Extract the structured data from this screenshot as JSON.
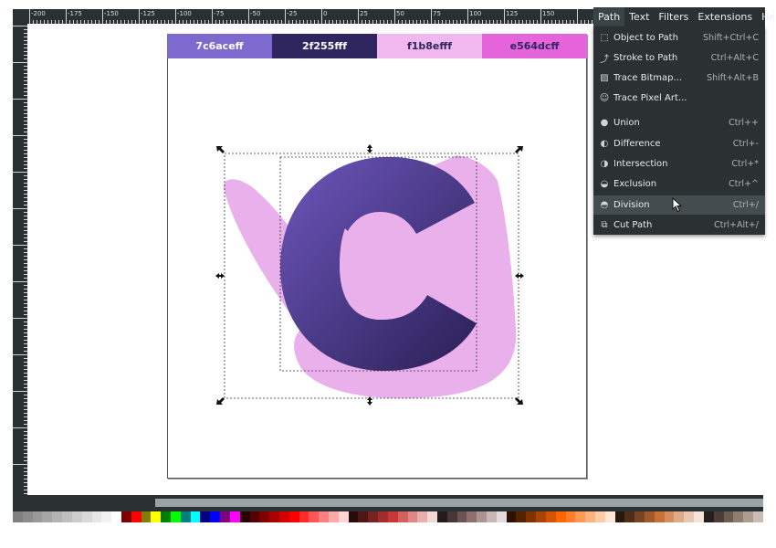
{
  "rulers": {
    "top_labels": [
      "-200",
      "-175",
      "-150",
      "-125",
      "-100",
      "-75",
      "-50",
      "-25",
      "0",
      "25",
      "50",
      "75",
      "100",
      "125",
      "150"
    ]
  },
  "swatches": [
    {
      "label": "7c6aceff",
      "bg": "#7c6ace",
      "fg": "#ffffff"
    },
    {
      "label": "2f255fff",
      "bg": "#2f255f",
      "fg": "#ffffff"
    },
    {
      "label": "f1b8efff",
      "bg": "#f1b8ef",
      "fg": "#2f255f"
    },
    {
      "label": "e564dcff",
      "bg": "#e564dc",
      "fg": "#2f255f"
    }
  ],
  "colors": {
    "pink_shape": "#eab0ec",
    "gradient_light": "#6e57bd",
    "gradient_dark": "#2a1f55"
  },
  "menubar": {
    "path": "Path",
    "text": "Text",
    "filters": "Filters",
    "extensions": "Extensions",
    "help": "Help"
  },
  "menu": {
    "object_to_path": {
      "label": "Object to Path",
      "shortcut": "Shift+Ctrl+C",
      "icon": "object-to-path-icon"
    },
    "stroke_to_path": {
      "label": "Stroke to Path",
      "shortcut": "Ctrl+Alt+C",
      "icon": "stroke-to-path-icon"
    },
    "trace_bitmap": {
      "label": "Trace Bitmap...",
      "shortcut": "Shift+Alt+B",
      "icon": "trace-bitmap-icon"
    },
    "trace_pixel_art": {
      "label": "Trace Pixel Art...",
      "shortcut": "",
      "icon": "trace-pixel-art-icon"
    },
    "union": {
      "label": "Union",
      "shortcut": "Ctrl++",
      "icon": "union-icon"
    },
    "difference": {
      "label": "Difference",
      "shortcut": "Ctrl+-",
      "icon": "difference-icon"
    },
    "intersection": {
      "label": "Intersection",
      "shortcut": "Ctrl+*",
      "icon": "intersection-icon"
    },
    "exclusion": {
      "label": "Exclusion",
      "shortcut": "Ctrl+^",
      "icon": "exclusion-icon"
    },
    "division": {
      "label": "Division",
      "shortcut": "Ctrl+/",
      "icon": "division-icon"
    },
    "cut_path": {
      "label": "Cut Path",
      "shortcut": "Ctrl+Alt+/",
      "icon": "cut-path-icon"
    }
  },
  "palette": [
    "#808080",
    "#8c8c8c",
    "#999999",
    "#a6a6a6",
    "#b3b3b3",
    "#bfbfbf",
    "#cccccc",
    "#d9d9d9",
    "#e6e6e6",
    "#f2f2f2",
    "#ffffff",
    "#800000",
    "#ff0000",
    "#808000",
    "#ffff00",
    "#008000",
    "#00ff00",
    "#008080",
    "#00ffff",
    "#000080",
    "#0000ff",
    "#800080",
    "#ff00ff",
    "#2b0000",
    "#550000",
    "#800000",
    "#aa0000",
    "#d40000",
    "#ff0000",
    "#ff2a2a",
    "#ff5555",
    "#ff8080",
    "#ffaaaa",
    "#ffd5d5",
    "#280b0b",
    "#501616",
    "#782121",
    "#a02c2c",
    "#c83737",
    "#d35f5f",
    "#de8787",
    "#e9afaf",
    "#f4d7d7",
    "#241c1c",
    "#483737",
    "#6c5353",
    "#916f6f",
    "#ac9393",
    "#c8b7b7",
    "#e3dbdb",
    "#2b1100",
    "#552200",
    "#803300",
    "#aa4400",
    "#d45500",
    "#ff6600",
    "#ff7f2a",
    "#ff9955",
    "#ffb380",
    "#ffccaa",
    "#ffe6d5",
    "#28170b",
    "#502d16",
    "#784421",
    "#a05a2c",
    "#c87137",
    "#d38d5f",
    "#deaa87",
    "#e9c6af",
    "#f4e3d7",
    "#241f1c",
    "#483e37",
    "#6c5d53",
    "#917c6f",
    "#ac9d93",
    "#c8beb7"
  ]
}
